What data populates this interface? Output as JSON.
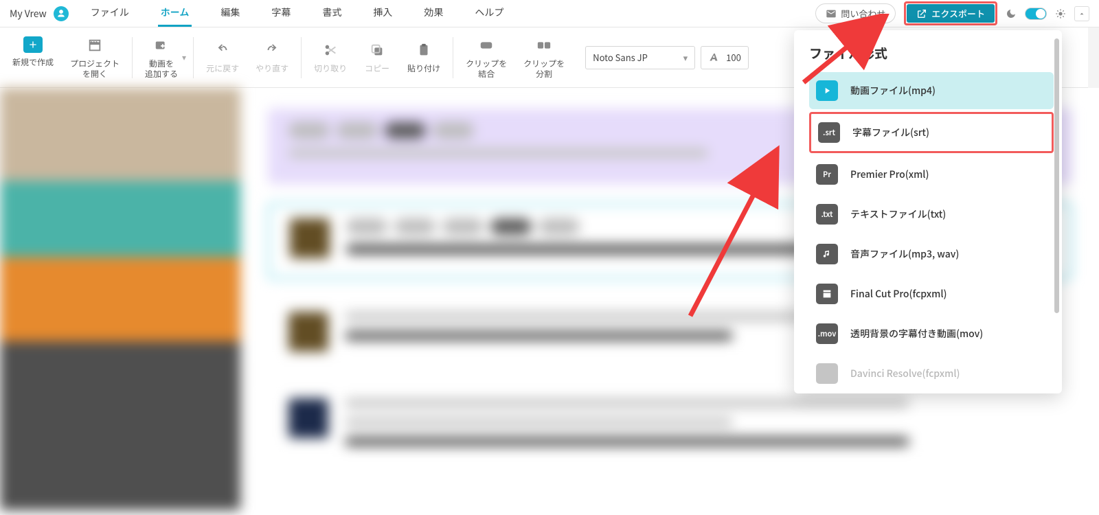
{
  "brand": "My Vrew",
  "menu": {
    "items": [
      "ファイル",
      "ホーム",
      "編集",
      "字幕",
      "書式",
      "挿入",
      "効果",
      "ヘルプ"
    ],
    "activeIndex": 1
  },
  "header": {
    "contact_label": "問い合わせ",
    "export_label": "エクスポート"
  },
  "toolbar": {
    "new_label": "新規で作成",
    "open_label": "プロジェクト\nを開く",
    "add_video_label": "動画を\n追加する",
    "undo_label": "元に戻す",
    "redo_label": "やり直す",
    "cut_label": "切り取り",
    "copy_label": "コピー",
    "paste_label": "貼り付け",
    "merge_label": "クリップを\n結合",
    "split_label": "クリップを\n分割",
    "font_name": "Noto Sans JP",
    "font_size": "100"
  },
  "export_panel": {
    "title": "ファイル形式",
    "items": [
      {
        "badge_kind": "play",
        "label": "動画ファイル(mp4)",
        "active": true
      },
      {
        "badge_kind": "text",
        "badge": ".srt",
        "label": "字幕ファイル(srt)",
        "highlight": true
      },
      {
        "badge_kind": "text",
        "badge": "Pr",
        "label": "Premier Pro(xml)"
      },
      {
        "badge_kind": "text",
        "badge": ".txt",
        "label": "テキストファイル(txt)"
      },
      {
        "badge_kind": "music",
        "label": "音声ファイル(mp3, wav)"
      },
      {
        "badge_kind": "clap",
        "label": "Final Cut Pro(fcpxml)"
      },
      {
        "badge_kind": "text",
        "badge": ".mov",
        "label": "透明背景の字幕付き動画(mov)"
      },
      {
        "badge_kind": "text",
        "badge": "",
        "label": "Davinci Resolve(fcpxml)",
        "cut": true
      }
    ]
  }
}
